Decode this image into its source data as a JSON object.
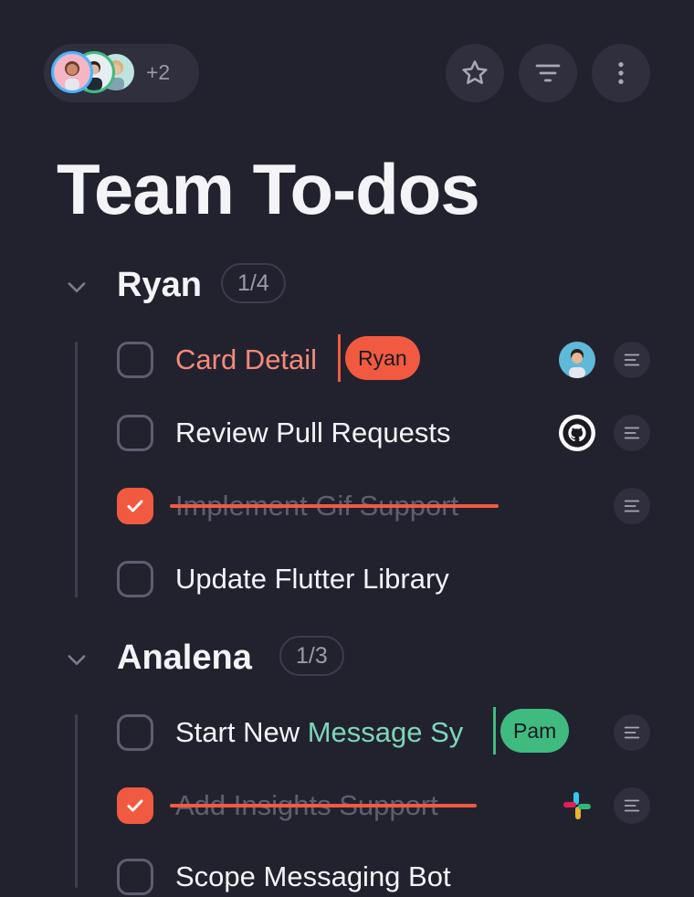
{
  "toolbar": {
    "more_members": "+2",
    "star_icon": "star-icon",
    "filter_icon": "filter-icon",
    "menu_icon": "more-vertical-icon"
  },
  "page": {
    "title": "Team To-dos"
  },
  "groups": [
    {
      "name": "Ryan",
      "count": "1/4",
      "tasks": [
        {
          "text": "Card Detail",
          "done": false,
          "collab": "Ryan",
          "collab_color": "#f15a40",
          "side_icon": "avatar"
        },
        {
          "text": "Review Pull Requests",
          "done": false,
          "side_icon": "github-icon"
        },
        {
          "text": "Implement Gif Support",
          "done": true
        },
        {
          "text": "Update Flutter Library",
          "done": false
        }
      ]
    },
    {
      "name": "Analena",
      "count": "1/3",
      "tasks": [
        {
          "text_prefix": "Start New ",
          "text_highlight": "Message Sy",
          "done": false,
          "collab": "Pam",
          "collab_color": "#3fbb7f"
        },
        {
          "text": "Add Insights Support",
          "done": true,
          "side_icon": "slack-icon"
        },
        {
          "text": "Scope Messaging Bot",
          "done": false
        }
      ]
    }
  ],
  "colors": {
    "background": "#22222f",
    "accent": "#f15a40",
    "collab_green": "#3fbb7f",
    "done_text": "#5f5f71"
  }
}
